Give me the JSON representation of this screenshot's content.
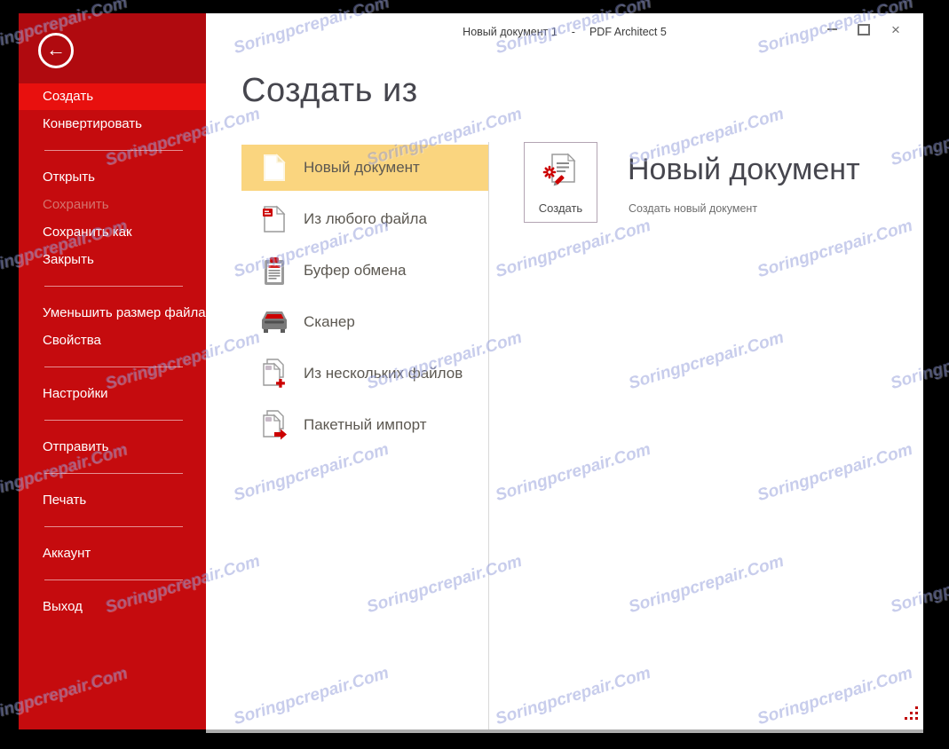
{
  "titlebar": {
    "document_name": "Новый документ 1",
    "separator": "-",
    "app_name": "PDF Architect 5",
    "close_glyph": "×"
  },
  "window_controls": {
    "minimize_icon": "minimize-icon",
    "maximize_icon": "maximize-icon",
    "close_icon": "close-icon"
  },
  "sidebar": {
    "back_icon": "back-arrow-icon",
    "back_glyph": "←",
    "items": [
      {
        "label": "Создать",
        "state": "selected"
      },
      {
        "label": "Конвертировать",
        "state": "normal"
      },
      {
        "label": "Открыть",
        "state": "normal"
      },
      {
        "label": "Сохранить",
        "state": "disabled"
      },
      {
        "label": "Сохранить как",
        "state": "normal"
      },
      {
        "label": "Закрыть",
        "state": "normal"
      },
      {
        "label": "Уменьшить размер файла",
        "state": "normal"
      },
      {
        "label": "Свойства",
        "state": "normal"
      },
      {
        "label": "Настройки",
        "state": "normal"
      },
      {
        "label": "Отправить",
        "state": "normal"
      },
      {
        "label": "Печать",
        "state": "normal"
      },
      {
        "label": "Аккаунт",
        "state": "normal"
      },
      {
        "label": "Выход",
        "state": "normal"
      }
    ]
  },
  "main": {
    "heading": "Создать из",
    "options": [
      {
        "label": "Новый документ",
        "icon": "new-document-icon",
        "selected": true
      },
      {
        "label": "Из любого файла",
        "icon": "file-any-icon",
        "selected": false
      },
      {
        "label": "Буфер обмена",
        "icon": "clipboard-icon",
        "selected": false
      },
      {
        "label": "Сканер",
        "icon": "scanner-icon",
        "selected": false
      },
      {
        "label": "Из нескольких файлов",
        "icon": "multiple-files-icon",
        "selected": false
      },
      {
        "label": "Пакетный импорт",
        "icon": "batch-import-icon",
        "selected": false
      }
    ],
    "detail": {
      "tile_button_label": "Создать",
      "tile_icon": "create-document-icon",
      "heading": "Новый документ",
      "description": "Создать новый документ"
    }
  },
  "watermark": {
    "text": "Soringpcrepair.Com"
  },
  "colors": {
    "brand_red": "#E30613",
    "sidebar_body": "#C50B0E",
    "sidebar_header": "#B00A0F",
    "sidebar_selected": "#E8100E",
    "option_highlight": "#FAD57F",
    "watermark_blue": "#7D87D2",
    "grip_red": "#C00000"
  }
}
